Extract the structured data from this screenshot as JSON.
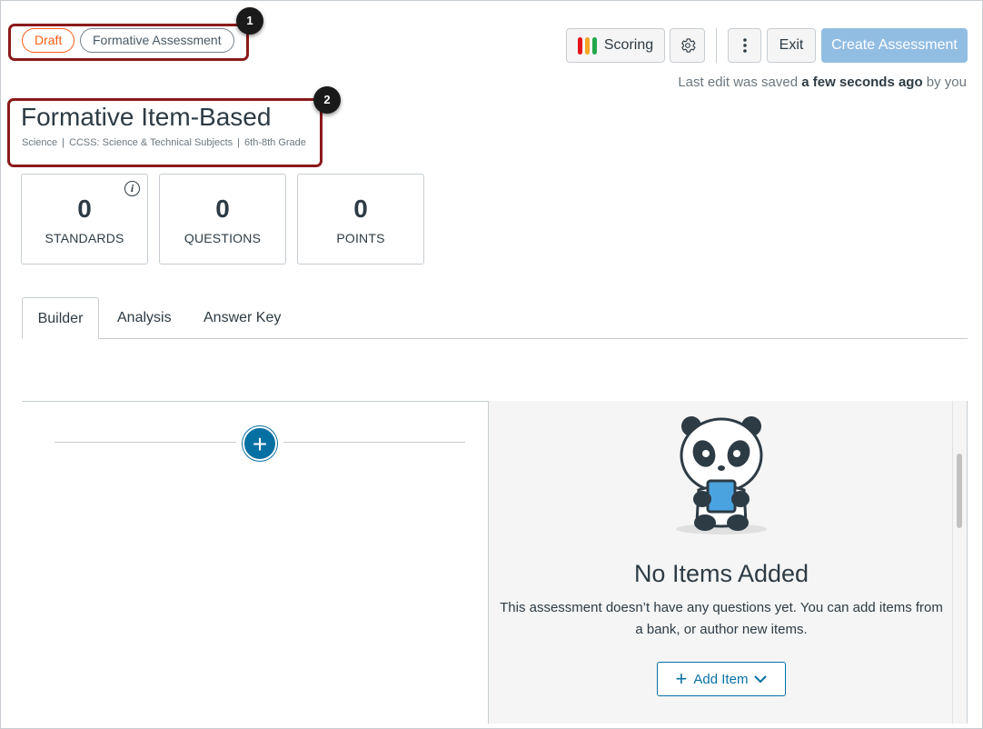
{
  "header": {
    "status_pill": "Draft",
    "type_pill": "Formative Assessment",
    "callouts": [
      "1",
      "2"
    ]
  },
  "toolbar": {
    "scoring_label": "Scoring",
    "exit_label": "Exit",
    "create_label": "Create Assessment",
    "scoring_bar_colors": [
      "#e5141c",
      "#f5a623",
      "#22a84a"
    ]
  },
  "saved": {
    "prefix": "Last edit was saved",
    "time": "a few seconds ago",
    "suffix": "by you"
  },
  "assessment": {
    "title": "Formative Item-Based",
    "subject": "Science",
    "standard": "CCSS: Science & Technical Subjects",
    "grade": "6th-8th Grade"
  },
  "stats": [
    {
      "value": "0",
      "label": "STANDARDS"
    },
    {
      "value": "0",
      "label": "QUESTIONS"
    },
    {
      "value": "0",
      "label": "POINTS"
    }
  ],
  "tabs": [
    {
      "label": "Builder"
    },
    {
      "label": "Analysis"
    },
    {
      "label": "Answer Key"
    }
  ],
  "empty_state": {
    "title": "No Items Added",
    "line1": "This assessment doesn’t have any questions yet. You can add items from",
    "line2": "a bank, or author new items.",
    "button_label": "Add Item"
  },
  "colors": {
    "accent": "#0770a3",
    "draft": "#fc5e13",
    "callout": "#8b1a1a",
    "create_button": "#92bde3"
  }
}
